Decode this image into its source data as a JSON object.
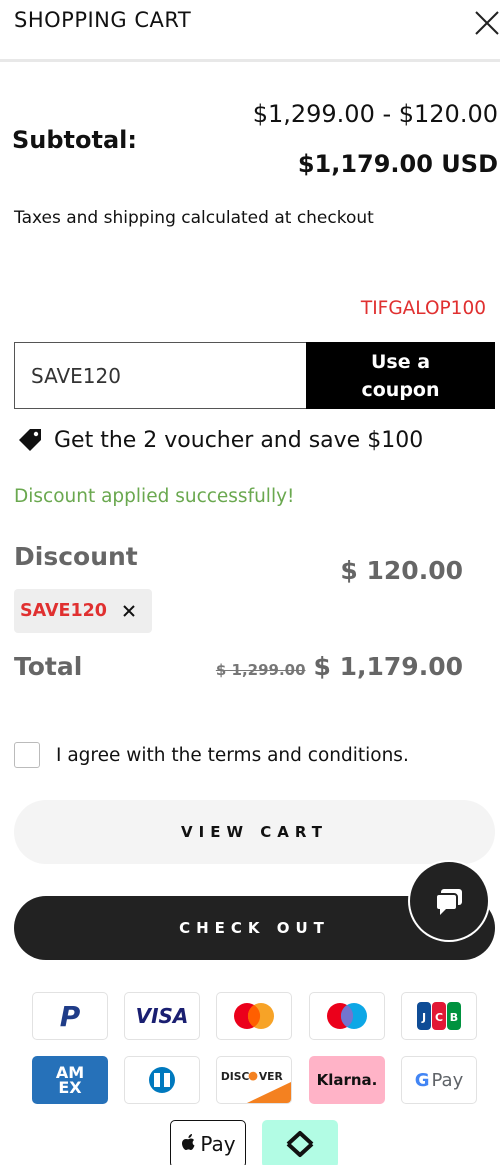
{
  "header": {
    "title": "SHOPPING CART",
    "close_icon": "close-icon"
  },
  "subtotal": {
    "label": "Subtotal:",
    "calculation": "$1,299.00 - $120.00",
    "total": "$1,179.00 USD"
  },
  "tax_note": "Taxes and shipping calculated at checkout",
  "applied_code": "TIFGALOP100",
  "coupon": {
    "input_value": "SAVE120",
    "button_line1": "Use a",
    "button_line2": "coupon"
  },
  "voucher": {
    "icon": "tag-icon",
    "text": "Get the 2 voucher and save $100"
  },
  "success_message": "Discount applied successfully!",
  "discount": {
    "label": "Discount",
    "amount": "$ 120.00",
    "code": "SAVE120",
    "remove_icon": "close-icon"
  },
  "total": {
    "label": "Total",
    "original": "$ 1,299.00",
    "final": "$ 1,179.00"
  },
  "terms": {
    "checked": false,
    "text": "I agree with the terms and conditions."
  },
  "buttons": {
    "view_cart": "VIEW CART",
    "checkout": "CHECK OUT"
  },
  "chat": {
    "icon": "chat-icon"
  },
  "payment_methods": {
    "paypal": "P",
    "visa": "VISA",
    "mastercard": "mastercard",
    "maestro": "maestro",
    "jcb": "JCB",
    "amex_line1": "AM",
    "amex_line2": "EX",
    "diners": "diners",
    "discover_left": "DISC",
    "discover_right": "VER",
    "klarna": "Klarna.",
    "gpay_g": "G",
    "gpay_text": "Pay",
    "applepay_text": "Pay",
    "afterpay": "afterpay"
  },
  "colors": {
    "accent_red": "#e03030",
    "success_green": "#6aa84f",
    "checkout_bg": "#222222",
    "view_cart_bg": "#f4f4f4",
    "klarna_pink": "#ffb3c7",
    "afterpay_mint": "#b2fce4",
    "amex_blue": "#2671b9",
    "paypal_blue": "#1f3c88",
    "visa_blue": "#1a1f71"
  }
}
